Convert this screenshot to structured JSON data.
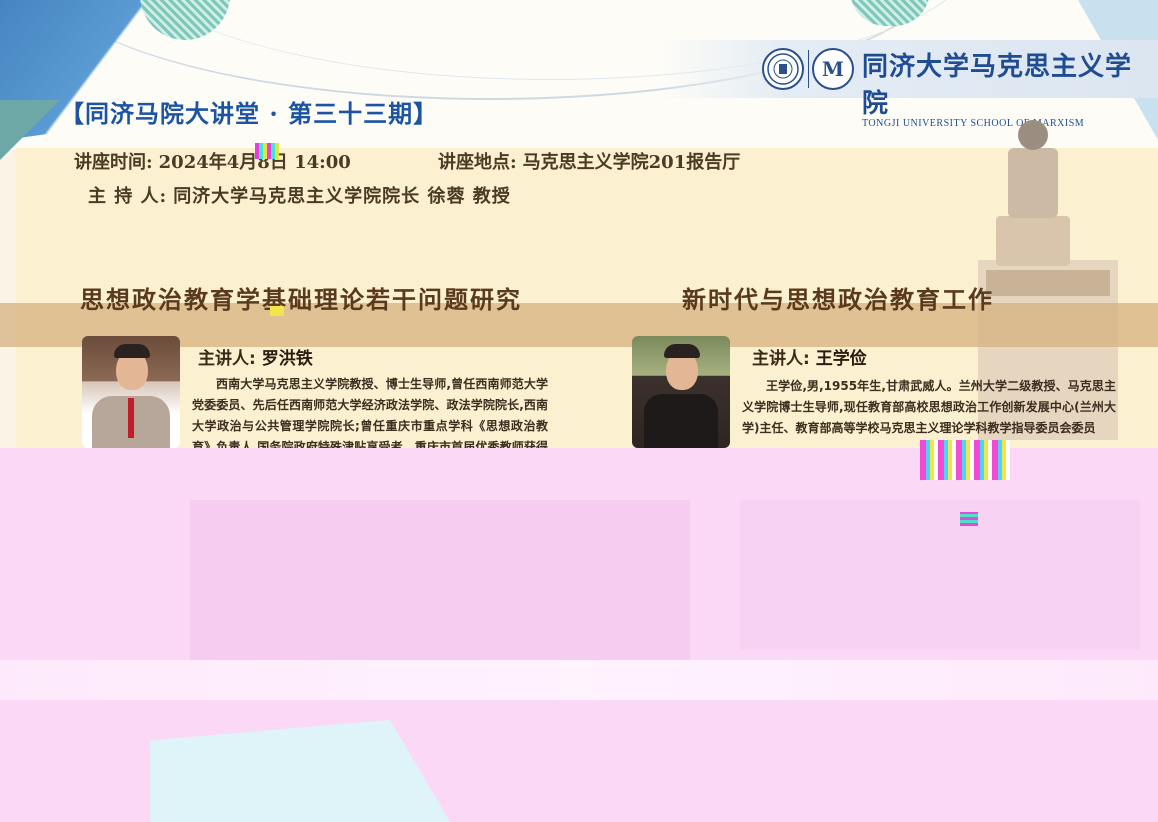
{
  "header": {
    "title": "【同济马院大讲堂 · 第三十三期】",
    "logo": {
      "name_cn": "同济大学马克思主义学院",
      "name_en": "TONGJI UNIVERSITY SCHOOL OF MARXISM",
      "seal_left_icon": "university-seal",
      "seal_right_letter": "M"
    }
  },
  "event": {
    "time_label": "讲座时间:",
    "time_value": "2024年4月8日 14:00",
    "venue_label": "讲座地点:",
    "venue_value": "马克思主义学院201报告厅",
    "host_label": "主 持 人:",
    "host_value": "同济大学马克思主义学院院长 徐蓉 教授"
  },
  "talks": [
    {
      "topic": "思想政治教育学基础理论若干问题研究",
      "speaker_label": "主讲人:",
      "speaker_name": "罗洪铁",
      "bio": "西南大学马克思主义学院教授、博士生导师,曾任西南师范大学党委委员、先后任西南师范大学经济政法学院、政法学院院长,西南大学政治与公共管理学院院长;曾任重庆市重点学科《思想政治教育》负责人,国务院政府特殊津贴享受者、重庆市首届优秀教师获得者、国家社科基金项目和"
    },
    {
      "topic": "新时代与思想政治教育工作",
      "speaker_label": "主讲人:",
      "speaker_name": "王学俭",
      "bio": "王学俭,男,1955年生,甘肃武威人。兰州大学二级教授、马克思主义学院博士生导师,现任教育部高校思想政治工作创新发展中心(兰州大学)主任、教育部高等学校马克思主义理论学科教学指导委员会委员"
    }
  ],
  "colors": {
    "title_blue": "#1c54a3",
    "cream": "#fbf0cf",
    "topic_band": "#d5b180",
    "pink_artifact": "#fbd9f6"
  }
}
